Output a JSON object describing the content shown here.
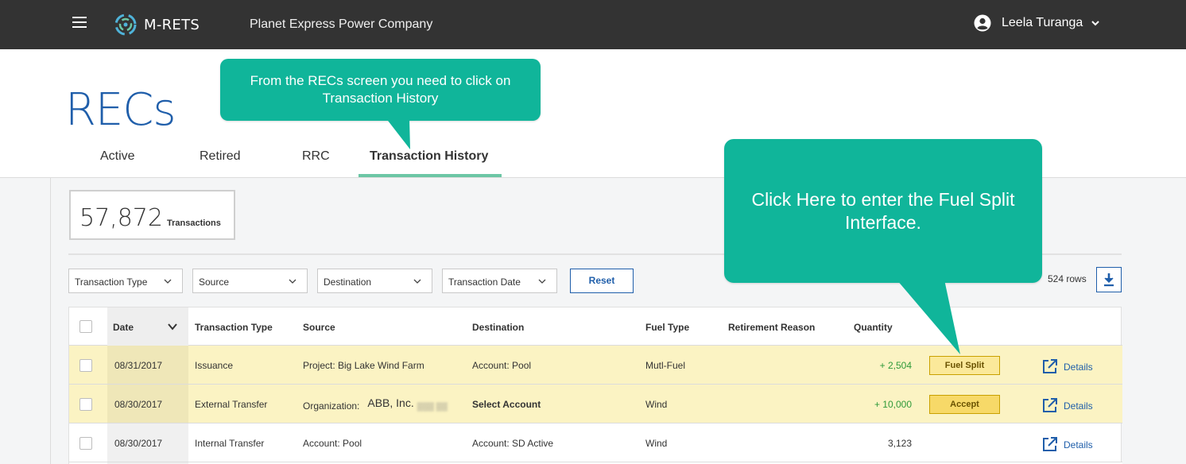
{
  "topbar": {
    "logo_text": "M-RETS",
    "company": "Planet Express Power Company",
    "user_name": "Leela Turanga"
  },
  "header": {
    "title": "RECs",
    "tabs": [
      {
        "label": "Active",
        "active": false
      },
      {
        "label": "Retired",
        "active": false
      },
      {
        "label": "RRC",
        "active": false
      },
      {
        "label": "Transaction History",
        "active": true
      }
    ]
  },
  "summary": {
    "count": "57,872",
    "count_label": "Transactions"
  },
  "filters": {
    "transaction_type": "Transaction Type",
    "source": "Source",
    "destination": "Destination",
    "transaction_date": "Transaction Date",
    "reset_label": "Reset",
    "rows_count": "524 rows"
  },
  "table": {
    "columns": [
      "Date",
      "Transaction Type",
      "Source",
      "Destination",
      "Fuel Type",
      "Retirement Reason",
      "Quantity"
    ],
    "rows": [
      {
        "date": "08/31/2017",
        "type": "Issuance",
        "source": "Project: Big Lake Wind Farm",
        "destination": "Account: Pool",
        "fuel": "Mutl-Fuel",
        "reason": "",
        "quantity": "+ 2,504",
        "action": "Fuel Split",
        "details": "Details"
      },
      {
        "date": "08/30/2017",
        "type": "External Transfer",
        "source_prefix": "Organization:",
        "source_name": "ABB, Inc.",
        "source_blur": "(obscured)",
        "destination": "Select Account",
        "fuel": "Wind",
        "reason": "",
        "quantity": "+ 10,000",
        "action": "Accept",
        "details": "Details"
      },
      {
        "date": "08/30/2017",
        "type": "Internal Transfer",
        "source": "Account: Pool",
        "destination": "Account: SD Active",
        "fuel": "Wind",
        "reason": "",
        "quantity": "3,123",
        "action": "",
        "details": "Details"
      }
    ]
  },
  "callouts": {
    "first": "From the RECs screen you need to click on Transaction History",
    "second": "Click Here to enter the Fuel Split Interface."
  },
  "colors": {
    "topbar": "#333333",
    "brand_blue": "#1f5eaa",
    "callout_green": "#10b59a",
    "highlight_row": "#fbf3c3",
    "tab_underline": "#6cc6a5"
  },
  "icons": [
    "hamburger-icon",
    "m-rets-logo-icon",
    "user-circle-icon",
    "chevron-down-icon",
    "download-icon",
    "external-link-icon"
  ]
}
